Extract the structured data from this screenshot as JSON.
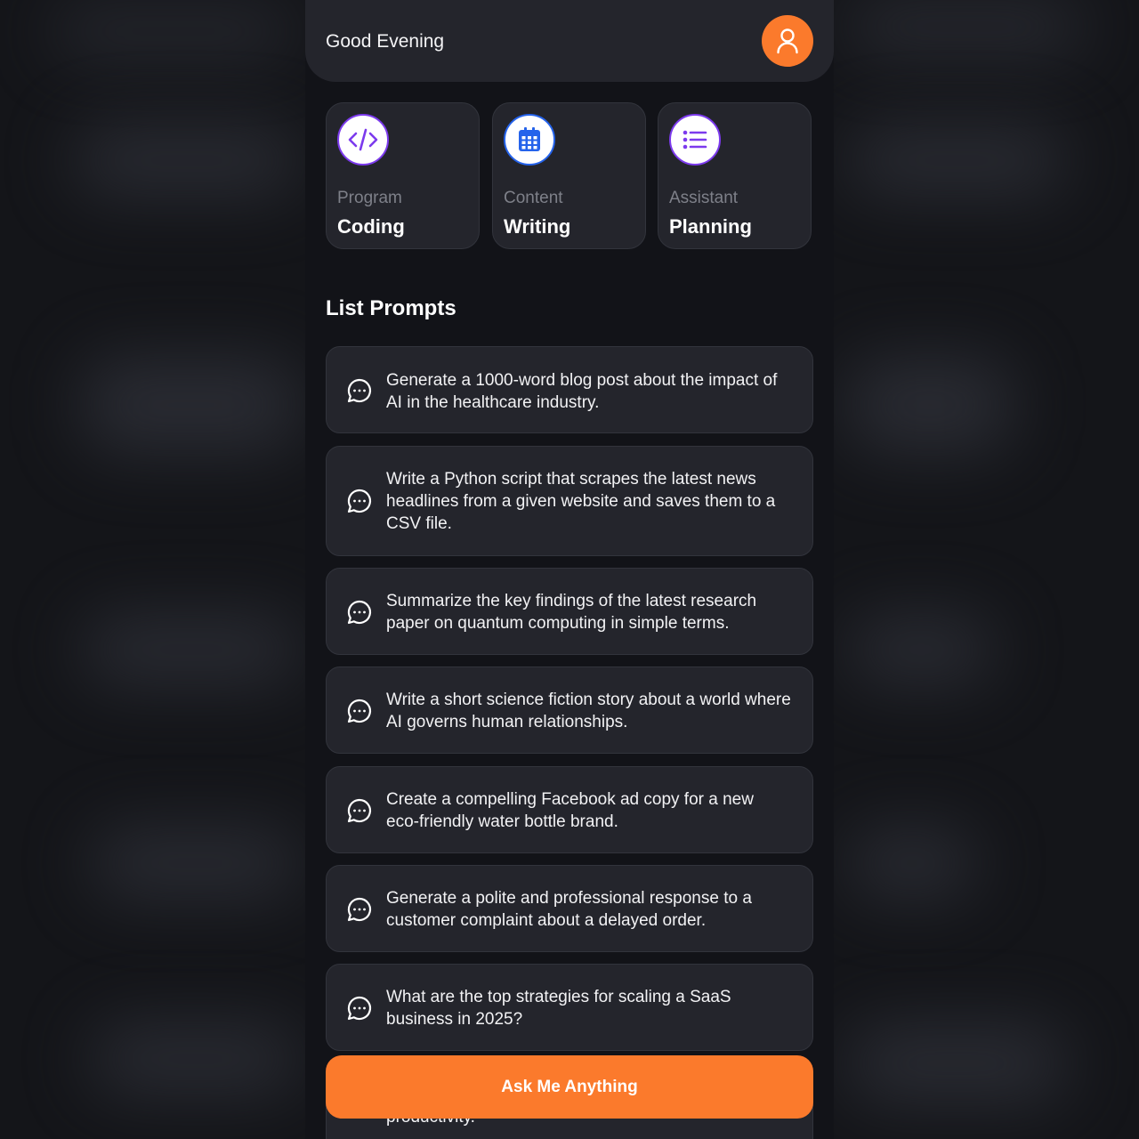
{
  "header": {
    "greeting": "Good Evening"
  },
  "categories": [
    {
      "subtitle": "Program",
      "title": "Coding",
      "icon": "code-icon",
      "color": "#7c3aed"
    },
    {
      "subtitle": "Content",
      "title": "Writing",
      "icon": "calendar-icon",
      "color": "#2563eb"
    },
    {
      "subtitle": "Assistant",
      "title": "Planning",
      "icon": "list-icon",
      "color": "#7c3aed"
    }
  ],
  "section_title": "List Prompts",
  "prompts": [
    "Generate a 1000-word blog post about the impact of AI in the healthcare industry.",
    "Write a Python script that scrapes the latest news headlines from a given website and saves them to a CSV file.",
    "Summarize the key findings of the latest research paper on quantum computing in simple terms.",
    "Write a short science fiction story about a world where AI governs human relationships.",
    "Create a compelling Facebook ad copy for a new eco-friendly water bottle brand.",
    "Generate a polite and professional response to a customer complaint about a delayed order.",
    "What are the top strategies for scaling a SaaS business in 2025?",
    "productivity."
  ],
  "cta_label": "Ask Me Anything",
  "colors": {
    "accent": "#fb7a2c",
    "card": "#24252c",
    "background": "#121318"
  }
}
